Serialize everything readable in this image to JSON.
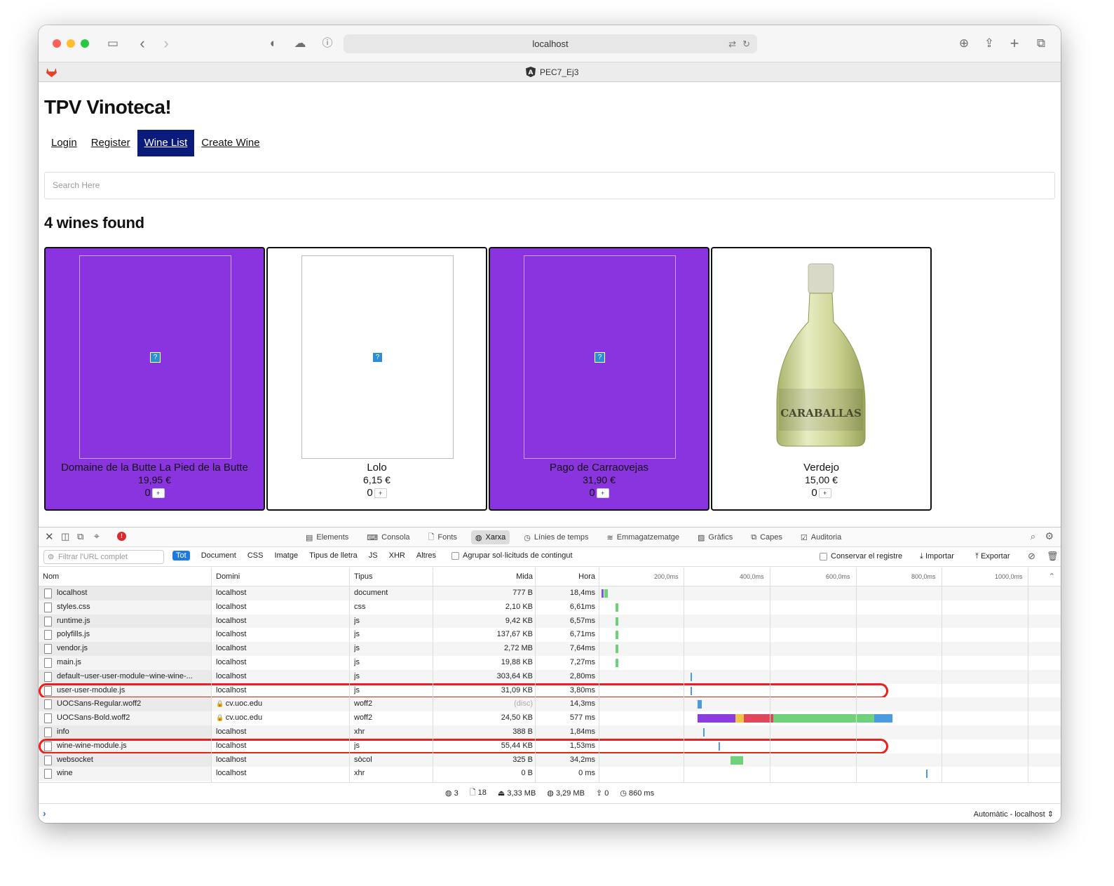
{
  "browser": {
    "url": "localhost",
    "tab_title": "PEC7_Ej3"
  },
  "app": {
    "title": "TPV Vinoteca!",
    "nav": [
      {
        "label": "Login",
        "active": false
      },
      {
        "label": "Register",
        "active": false
      },
      {
        "label": "Wine List",
        "active": true
      },
      {
        "label": "Create Wine",
        "active": false
      }
    ],
    "search_placeholder": "Search Here",
    "found_label": "4 wines found",
    "wines": [
      {
        "name": "Domaine de la Butte La Pied de la Butte",
        "price": "19,95 €",
        "qty": "0",
        "style": "purple",
        "image": "broken"
      },
      {
        "name": "Lolo",
        "price": "6,15 €",
        "qty": "0",
        "style": "white",
        "image": "broken"
      },
      {
        "name": "Pago de Carraovejas",
        "price": "31,90 €",
        "qty": "0",
        "style": "purple",
        "image": "broken"
      },
      {
        "name": "Verdejo",
        "price": "15,00 €",
        "qty": "0",
        "style": "white",
        "image": "bottle"
      }
    ],
    "colors": {
      "purple": "#8a34df",
      "nav_active": "#0b1b7c"
    }
  },
  "devtools": {
    "tabs": [
      "Elements",
      "Consola",
      "Fonts",
      "Xarxa",
      "Línies de temps",
      "Emmagatzematge",
      "Gràfics",
      "Capes",
      "Auditoria"
    ],
    "active_tab": "Xarxa",
    "filter_placeholder": "Filtrar l'URL complet",
    "filter_types": [
      "Tot",
      "Document",
      "CSS",
      "Imatge",
      "Tipus de lletra",
      "JS",
      "XHR",
      "Altres"
    ],
    "group_label": "Agrupar sol·licituds de contingut",
    "preserve_label": "Conservar el registre",
    "import_label": "Importar",
    "export_label": "Exportar",
    "columns": {
      "name": "Nom",
      "domain": "Domini",
      "type": "Tipus",
      "size": "Mida",
      "time": "Hora"
    },
    "timeline_ticks": [
      "200,0ms",
      "400,0ms",
      "600,0ms",
      "800,0ms",
      "1000,0ms"
    ],
    "requests": [
      {
        "name": "localhost",
        "domain": "localhost",
        "type": "document",
        "size": "777 B",
        "time": "18,4ms",
        "highlighted": false,
        "secure": false
      },
      {
        "name": "styles.css",
        "domain": "localhost",
        "type": "css",
        "size": "2,10 KB",
        "time": "6,61ms",
        "highlighted": false,
        "secure": false
      },
      {
        "name": "runtime.js",
        "domain": "localhost",
        "type": "js",
        "size": "9,42 KB",
        "time": "6,57ms",
        "highlighted": false,
        "secure": false
      },
      {
        "name": "polyfills.js",
        "domain": "localhost",
        "type": "js",
        "size": "137,67 KB",
        "time": "6,71ms",
        "highlighted": false,
        "secure": false
      },
      {
        "name": "vendor.js",
        "domain": "localhost",
        "type": "js",
        "size": "2,72 MB",
        "time": "7,64ms",
        "highlighted": false,
        "secure": false
      },
      {
        "name": "main.js",
        "domain": "localhost",
        "type": "js",
        "size": "19,88 KB",
        "time": "7,27ms",
        "highlighted": false,
        "secure": false
      },
      {
        "name": "default~user-user-module~wine-wine-...",
        "domain": "localhost",
        "type": "js",
        "size": "303,64 KB",
        "time": "2,80ms",
        "highlighted": false,
        "secure": false
      },
      {
        "name": "user-user-module.js",
        "domain": "localhost",
        "type": "js",
        "size": "31,09 KB",
        "time": "3,80ms",
        "highlighted": true,
        "secure": false
      },
      {
        "name": "UOCSans-Regular.woff2",
        "domain": "cv.uoc.edu",
        "type": "woff2",
        "size": "(disc)",
        "time": "14,3ms",
        "highlighted": false,
        "secure": true
      },
      {
        "name": "UOCSans-Bold.woff2",
        "domain": "cv.uoc.edu",
        "type": "woff2",
        "size": "24,50 KB",
        "time": "577 ms",
        "highlighted": false,
        "secure": true
      },
      {
        "name": "info",
        "domain": "localhost",
        "type": "xhr",
        "size": "388 B",
        "time": "1,84ms",
        "highlighted": false,
        "secure": false
      },
      {
        "name": "wine-wine-module.js",
        "domain": "localhost",
        "type": "js",
        "size": "55,44 KB",
        "time": "1,53ms",
        "highlighted": true,
        "secure": false
      },
      {
        "name": "websocket",
        "domain": "localhost",
        "type": "sòcol",
        "size": "325 B",
        "time": "34,2ms",
        "highlighted": false,
        "secure": false
      },
      {
        "name": "wine",
        "domain": "localhost",
        "type": "xhr",
        "size": "0 B",
        "time": "0 ms",
        "highlighted": false,
        "secure": false
      }
    ],
    "status": {
      "domains": "3",
      "resources": "18",
      "transferred": "3,33 MB",
      "size": "3,29 MB",
      "errors": "0",
      "load_time": "860 ms"
    },
    "console_context": "Automàtic - localhost"
  }
}
